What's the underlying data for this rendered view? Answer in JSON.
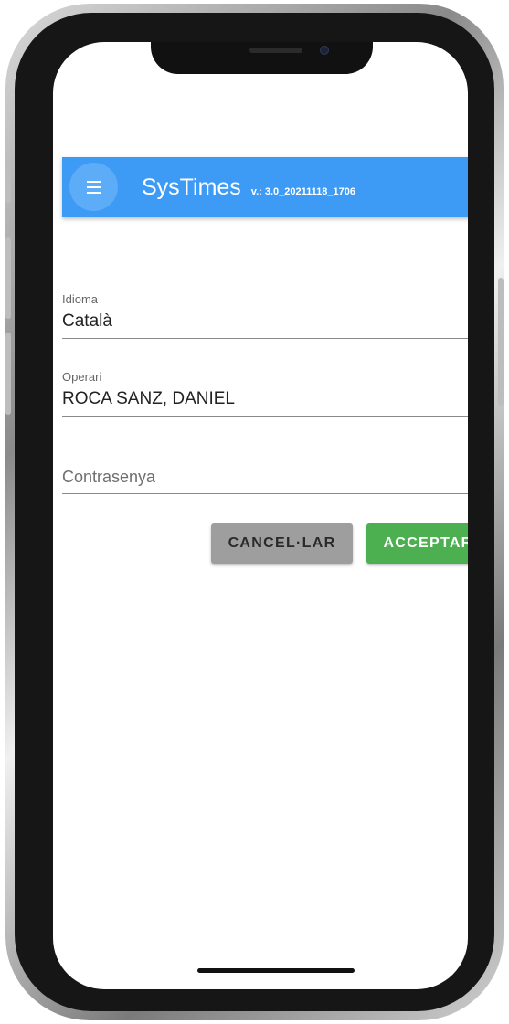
{
  "app": {
    "title": "SysTimes",
    "version": "v.: 3.0_20211118_1706",
    "accent_color": "#3d9bf5"
  },
  "form": {
    "language": {
      "label": "Idioma",
      "value": "Català"
    },
    "operator": {
      "label": "Operari",
      "value": "ROCA SANZ, DANIEL"
    },
    "password": {
      "placeholder": "Contrasenya",
      "value": ""
    }
  },
  "actions": {
    "cancel_label": "CANCEL·LAR",
    "accept_label": "ACCEPTAR",
    "cancel_color": "#9e9e9e",
    "accept_color": "#4caf50"
  },
  "icons": {
    "menu": "menu-icon",
    "dropdown": "chevron-down-icon"
  }
}
